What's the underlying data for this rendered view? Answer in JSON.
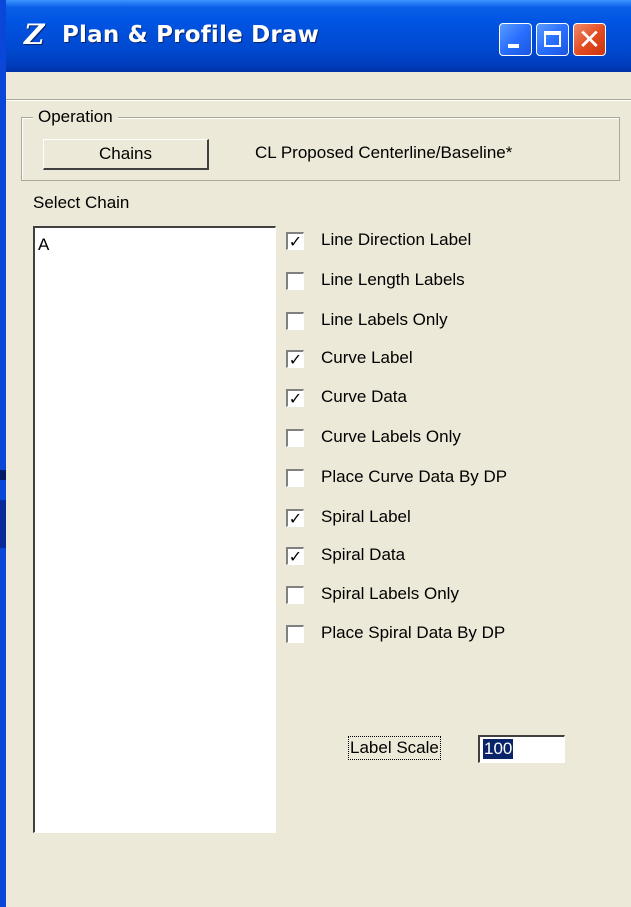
{
  "window": {
    "title": "Plan & Profile Draw",
    "app_icon": "Z",
    "icons": {
      "app": "app-logo-icon",
      "minimize": "minimize-icon",
      "maximize": "maximize-icon",
      "close": "close-icon"
    },
    "close_glyph": "✕"
  },
  "operation": {
    "group_label": "Operation",
    "button_label": "Chains",
    "description": "CL Proposed Centerline/Baseline*"
  },
  "chain": {
    "label": "Select Chain",
    "items": [
      "A"
    ]
  },
  "options": [
    {
      "label": "Line Direction Label",
      "checked": true
    },
    {
      "label": "Line Length Labels",
      "checked": false
    },
    {
      "label": "Line Labels Only",
      "checked": false
    },
    {
      "label": "Curve Label",
      "checked": true
    },
    {
      "label": "Curve Data",
      "checked": true
    },
    {
      "label": "Curve Labels Only",
      "checked": false
    },
    {
      "label": "Place Curve Data By DP",
      "checked": false
    },
    {
      "label": "Spiral Label",
      "checked": true
    },
    {
      "label": "Spiral Data",
      "checked": true
    },
    {
      "label": "Spiral Labels Only",
      "checked": false
    },
    {
      "label": "Place Spiral Data By DP",
      "checked": false
    }
  ],
  "label_scale": {
    "label": "Label Scale",
    "value": "100"
  },
  "colors": {
    "titlebar": "#0054e3",
    "window_bg": "#ece9d8",
    "selection": "#0a246a",
    "close_button": "#e24a1e"
  }
}
